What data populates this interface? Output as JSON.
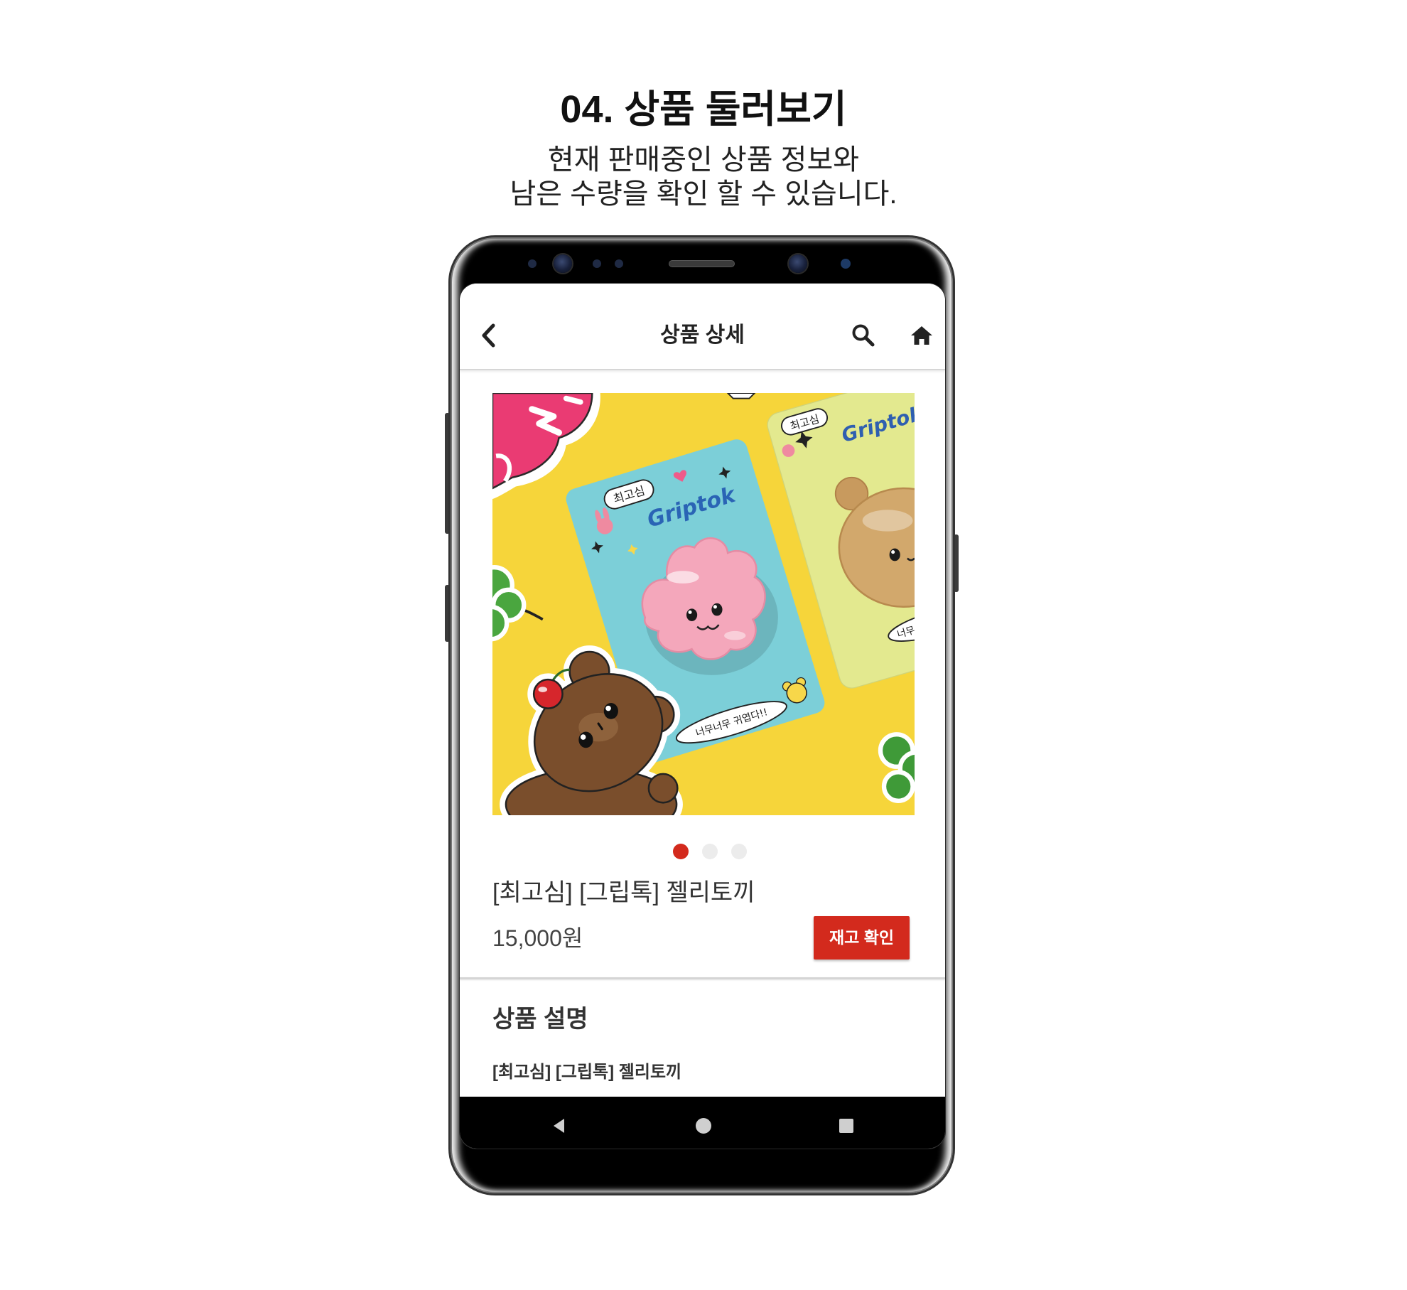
{
  "page": {
    "title": "04. 상품 둘러보기",
    "subtitle": [
      "현재 판매중인 상품 정보와",
      "남은 수량을 확인 할 수 있습니다."
    ]
  },
  "app": {
    "header": {
      "title": "상품 상세",
      "icons": {
        "back": "back-chevron-icon",
        "search": "search-icon",
        "home": "home-icon"
      }
    },
    "product": {
      "image": {
        "card_texts": {
          "bubble": "최고심",
          "brand": "Griptok",
          "caption": "너무너무 귀엽다!!"
        }
      },
      "carousel": {
        "dot_count": 3,
        "active_index": 0
      },
      "name": "[최고심] [그립톡] 젤리토끼",
      "price": "15,000원",
      "stock_button": "재고 확인"
    },
    "description": {
      "heading": "상품 설명",
      "body": "[최고심] [그립톡] 젤리토끼"
    },
    "nav_bar": {
      "icons": [
        "nav-back-icon",
        "nav-home-icon",
        "nav-recents-icon"
      ]
    }
  },
  "colors": {
    "accent": "#d32a1d",
    "dot_inactive": "#ececec",
    "text": "#333333",
    "image_background": "#f6d53a"
  }
}
